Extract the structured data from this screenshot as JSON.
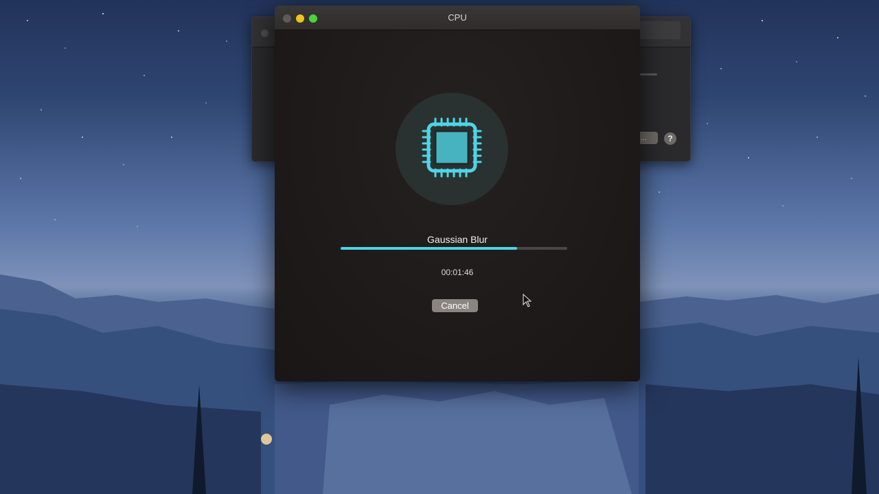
{
  "background_window": {
    "button_label": "ced...",
    "help_label": "?"
  },
  "window": {
    "title": "CPU",
    "icon": "cpu-chip-icon",
    "task_name": "Gaussian Blur",
    "progress_percent": 78,
    "elapsed_time": "00:01:46",
    "cancel_label": "Cancel"
  },
  "colors": {
    "accent": "#4fd4e8",
    "window_bg": "#1e1b1a",
    "button_bg": "#8a8581"
  }
}
